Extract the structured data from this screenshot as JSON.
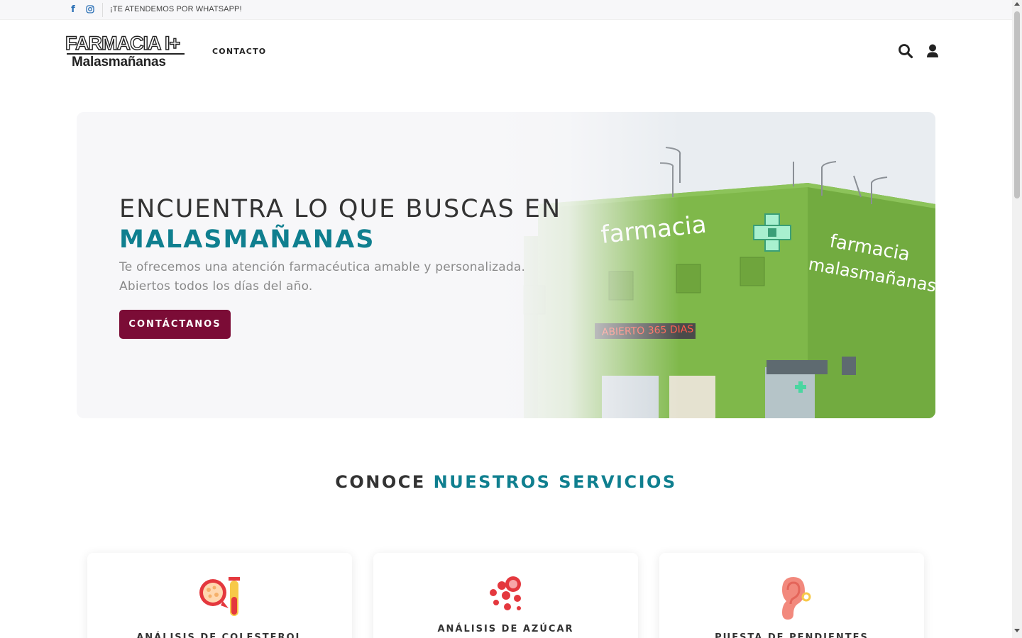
{
  "topbar": {
    "facebook_icon": "facebook-icon",
    "instagram_icon": "instagram-icon",
    "whatsapp_text": "¡TE ATENDEMOS POR WHATSAPP!"
  },
  "header": {
    "logo_line1": "FARMACIA I+",
    "logo_line2": "Malasmañanas",
    "nav": [
      {
        "label": "CONTACTO"
      }
    ],
    "search_icon": "search-icon",
    "user_icon": "user-icon"
  },
  "hero": {
    "title_line1": "ENCUENTRA LO QUE BUSCAS EN",
    "title_line2": "MALASMAÑANAS",
    "description": "Te ofrecemos una atención farmacéutica amable y personalizada. Abiertos todos los días del año.",
    "cta_label": "CONTÁCTANOS",
    "image_sign_1": "farmacia",
    "image_sign_2": "farmacia",
    "image_sign_3": "malasmañanas",
    "image_sign_4": "ABIERTO 365 DIAS"
  },
  "services": {
    "title_part1": "CONOCE",
    "title_part2": "NUESTROS SERVICIOS",
    "cards": [
      {
        "title": "ANÁLISIS DE COLESTEROL",
        "icon": "cholesterol-icon"
      },
      {
        "title": "ANÁLISIS DE AZÚCAR",
        "icon": "blood-sugar-icon"
      },
      {
        "title": "PUESTA DE PENDIENTES",
        "icon": "ear-piercing-icon"
      }
    ]
  },
  "colors": {
    "accent": "#0f7f8f",
    "cta": "#7b0c36",
    "facebook": "#2a6fb5",
    "building_green": "#7fb84a"
  }
}
